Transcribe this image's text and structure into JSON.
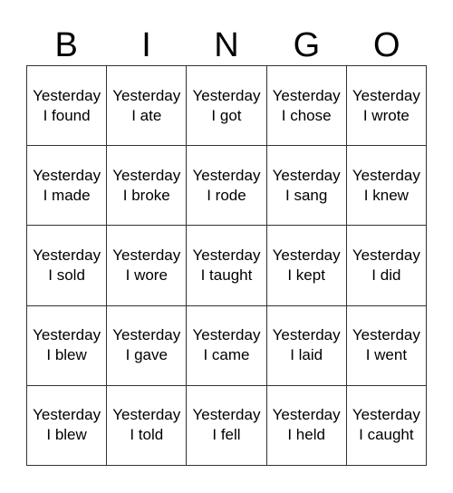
{
  "header": {
    "letters": [
      "B",
      "I",
      "N",
      "G",
      "O"
    ]
  },
  "card": {
    "rows": [
      [
        "Yesterday\nI found",
        "Yesterday\nI ate",
        "Yesterday\nI got",
        "Yesterday\nI chose",
        "Yesterday\nI wrote"
      ],
      [
        "Yesterday\nI made",
        "Yesterday\nI broke",
        "Yesterday\nI rode",
        "Yesterday\nI sang",
        "Yesterday\nI knew"
      ],
      [
        "Yesterday\nI sold",
        "Yesterday\nI wore",
        "Yesterday\nI taught",
        "Yesterday\nI kept",
        "Yesterday\nI did"
      ],
      [
        "Yesterday\nI blew",
        "Yesterday\nI gave",
        "Yesterday\nI came",
        "Yesterday\nI laid",
        "Yesterday\nI went"
      ],
      [
        "Yesterday\nI blew",
        "Yesterday\nI told",
        "Yesterday\nI fell",
        "Yesterday\nI held",
        "Yesterday\nI caught"
      ]
    ]
  }
}
